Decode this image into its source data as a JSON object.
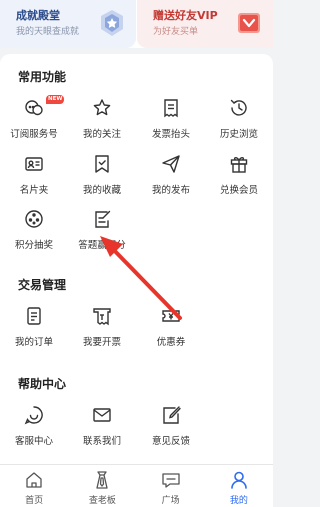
{
  "top_cards": {
    "achievement": {
      "title": "成就殿堂",
      "subtitle": "我的天眼查成就"
    },
    "vip": {
      "title": "赠送好友VIP",
      "subtitle": "为好友买单"
    }
  },
  "sections": {
    "common": {
      "title": "常用功能",
      "items": [
        {
          "label": "订阅服务号",
          "icon": "chat-bubbles-icon",
          "badge": "NEW"
        },
        {
          "label": "我的关注",
          "icon": "star-icon"
        },
        {
          "label": "发票抬头",
          "icon": "invoice-icon"
        },
        {
          "label": "历史浏览",
          "icon": "history-icon"
        },
        {
          "label": "名片夹",
          "icon": "business-card-icon"
        },
        {
          "label": "我的收藏",
          "icon": "collection-icon"
        },
        {
          "label": "我的发布",
          "icon": "send-icon"
        },
        {
          "label": "兑换会员",
          "icon": "gift-icon"
        },
        {
          "label": "积分抽奖",
          "icon": "lottery-icon"
        },
        {
          "label": "答题赢积分",
          "icon": "quiz-icon"
        }
      ]
    },
    "trade": {
      "title": "交易管理",
      "items": [
        {
          "label": "我的订单",
          "icon": "order-icon"
        },
        {
          "label": "我要开票",
          "icon": "invoice-request-icon"
        },
        {
          "label": "优惠券",
          "icon": "coupon-icon"
        }
      ]
    },
    "help": {
      "title": "帮助中心",
      "items": [
        {
          "label": "客服中心",
          "icon": "customer-service-icon"
        },
        {
          "label": "联系我们",
          "icon": "mail-icon"
        },
        {
          "label": "意见反馈",
          "icon": "feedback-icon"
        }
      ]
    }
  },
  "tabbar": {
    "items": [
      {
        "label": "首页",
        "icon": "home-icon"
      },
      {
        "label": "查老板",
        "icon": "boss-icon"
      },
      {
        "label": "广场",
        "icon": "square-icon"
      },
      {
        "label": "我的",
        "icon": "profile-icon",
        "active": true
      }
    ]
  },
  "colors": {
    "accent": "#2d6bf1",
    "annotation_arrow": "#e8352b",
    "badge": "#f0483e"
  }
}
